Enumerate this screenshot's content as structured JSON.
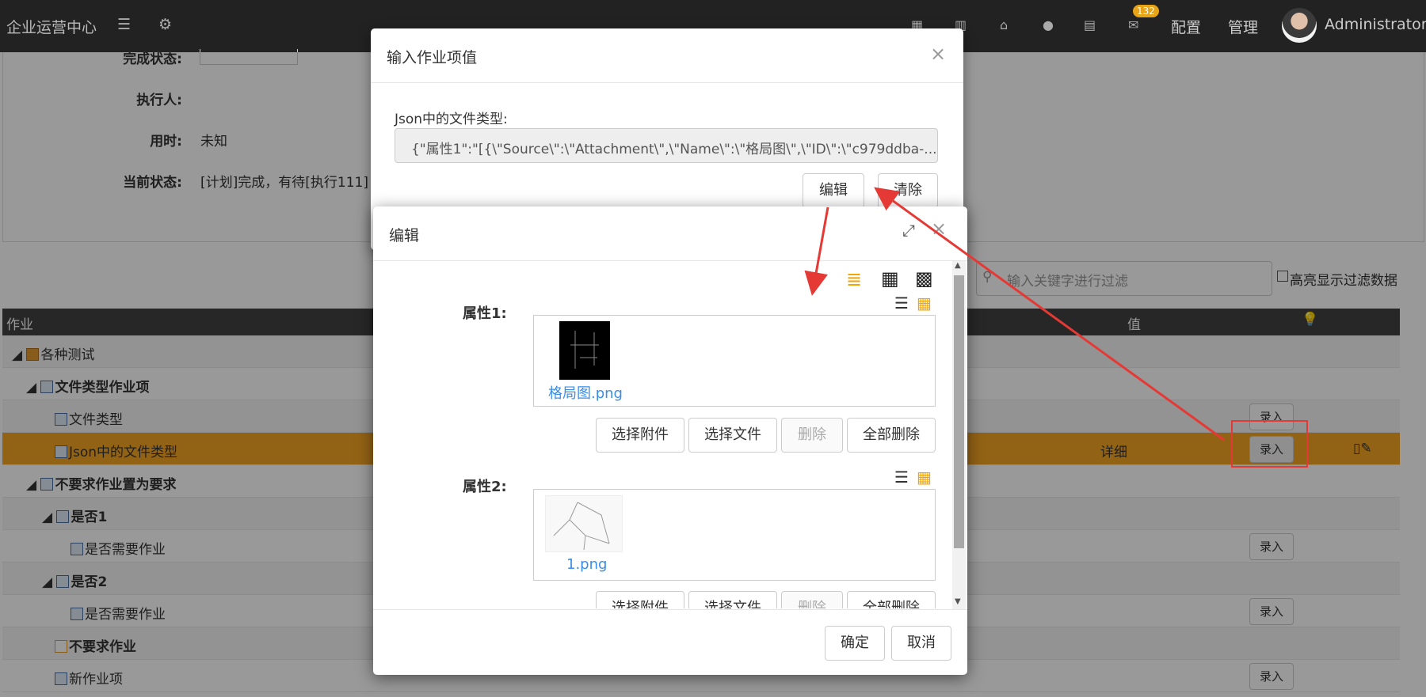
{
  "navbar": {
    "brand": "企业运营中心",
    "badge": "132",
    "config_label": "配置",
    "manage_label": "管理",
    "user": "Administrator"
  },
  "page": {
    "completion_label": "完成状态:",
    "executor_label": "执行人:",
    "time_label": "用时:",
    "time_value": "未知",
    "status_label": "当前状态:",
    "status_value": "[计划]完成，有待[执行111]",
    "filter_placeholder": "输入关键字进行过滤",
    "highlight_label": "高亮显示过滤数据",
    "col_task": "作业",
    "col_value": "值",
    "rows": [
      {
        "label": "各种测试",
        "bold": false
      },
      {
        "label": "文件类型作业项",
        "bold": true
      },
      {
        "label": "文件类型",
        "bold": false,
        "btn": "录入"
      },
      {
        "label": "Json中的文件类型",
        "bold": false,
        "btn": "录入",
        "value": "详细"
      },
      {
        "label": "不要求作业置为要求",
        "bold": true
      },
      {
        "label": "是否1",
        "bold": true
      },
      {
        "label": "是否需要作业",
        "bold": false,
        "btn": "录入"
      },
      {
        "label": "是否2",
        "bold": true
      },
      {
        "label": "是否需要作业",
        "bold": false,
        "btn": "录入"
      },
      {
        "label": "不要求作业",
        "bold": true
      },
      {
        "label": "新作业项",
        "bold": false,
        "btn": "录入"
      }
    ]
  },
  "modal1": {
    "title": "输入作业项值",
    "field_label": "Json中的文件类型:",
    "field_value": "{\"属性1\":\"[{\\\"Source\\\":\\\"Attachment\\\",\\\"Name\\\":\\\"格局图\\\",\\\"ID\\\":\\\"c979ddba-...",
    "edit_btn": "编辑",
    "clear_btn": "清除",
    "close": "×"
  },
  "modal2": {
    "title": "编辑",
    "close": "×",
    "props": [
      {
        "label": "属性1:",
        "file": "格局图.png"
      },
      {
        "label": "属性2:",
        "file": "1.png"
      }
    ],
    "btn_attach": "选择附件",
    "btn_file": "选择文件",
    "btn_delete": "删除",
    "btn_delete_all": "全部删除",
    "ok": "确定",
    "cancel": "取消"
  },
  "colors": {
    "accent": "#f5a623",
    "link": "#3a8ee6",
    "annotation": "#e53935"
  }
}
